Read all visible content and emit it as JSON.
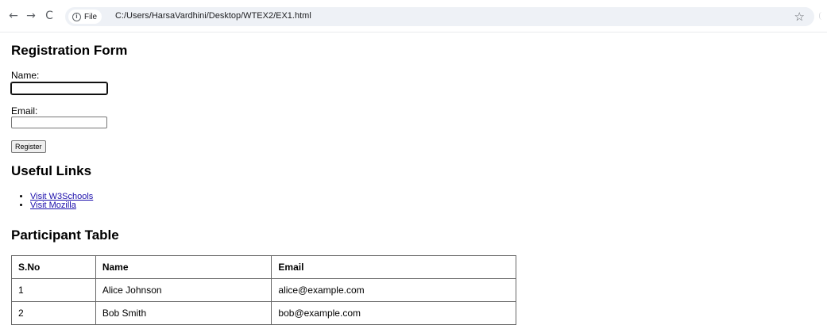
{
  "browser": {
    "back_icon": "←",
    "forward_icon": "→",
    "reload_icon": "C",
    "site_info_label": "File",
    "url": "C:/Users/HarsaVardhini/Desktop/WTEX2/EX1.html",
    "bookmark_icon": "☆"
  },
  "registration": {
    "heading": "Registration Form",
    "name_label": "Name:",
    "name_value": "",
    "email_label": "Email:",
    "email_value": "",
    "register_label": "Register"
  },
  "links": {
    "heading": "Useful Links",
    "items": [
      {
        "label": "Visit W3Schools"
      },
      {
        "label": "Visit Mozilla"
      }
    ]
  },
  "table": {
    "heading": "Participant Table",
    "columns": [
      "S.No",
      "Name",
      "Email"
    ],
    "rows": [
      [
        "1",
        "Alice Johnson",
        "alice@example.com"
      ],
      [
        "2",
        "Bob Smith",
        "bob@example.com"
      ]
    ]
  },
  "colors": {
    "link": "#1a0dab",
    "omnibox": "#eef1f6"
  }
}
